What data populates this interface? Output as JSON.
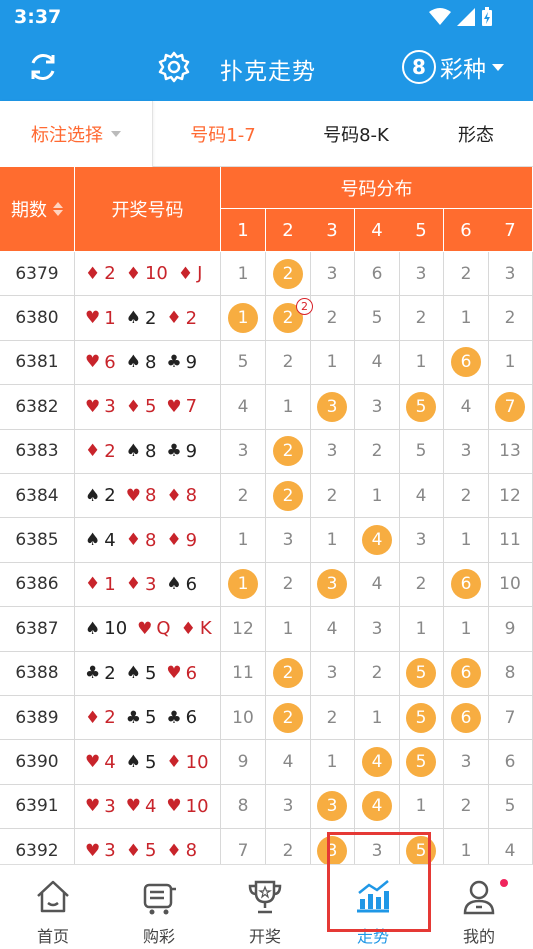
{
  "status_bar": {
    "time": "3:37"
  },
  "app_bar": {
    "title": "扑克走势",
    "variety_number": "8",
    "variety_label": "彩种"
  },
  "filter_tabs": {
    "mark_select": "标注选择",
    "tab1": "号码1-7",
    "tab2": "号码8-K",
    "tab3": "形态"
  },
  "table": {
    "headers": {
      "period": "期数",
      "draw": "开奖号码",
      "distribution": "号码分布"
    },
    "columns": [
      "1",
      "2",
      "3",
      "4",
      "5",
      "6",
      "7"
    ],
    "rows": [
      {
        "period": "6379",
        "cards": [
          [
            "♦",
            "2",
            "red"
          ],
          [
            "♦",
            "10",
            "red"
          ],
          [
            "♦",
            "J",
            "red"
          ]
        ],
        "cells": [
          [
            "1",
            false
          ],
          [
            "2",
            true
          ],
          [
            "3",
            false
          ],
          [
            "6",
            false
          ],
          [
            "3",
            false
          ],
          [
            "2",
            false
          ],
          [
            "3",
            false
          ]
        ]
      },
      {
        "period": "6380",
        "cards": [
          [
            "♥",
            "1",
            "red"
          ],
          [
            "♠",
            "2",
            "black"
          ],
          [
            "♦",
            "2",
            "red"
          ]
        ],
        "cells": [
          [
            "1",
            true
          ],
          [
            "2",
            true
          ],
          [
            "2",
            false
          ],
          [
            "5",
            false
          ],
          [
            "2",
            false
          ],
          [
            "1",
            false
          ],
          [
            "2",
            false
          ]
        ],
        "repeat_badge": "2"
      },
      {
        "period": "6381",
        "cards": [
          [
            "♥",
            "6",
            "red"
          ],
          [
            "♠",
            "8",
            "black"
          ],
          [
            "♣",
            "9",
            "black"
          ]
        ],
        "cells": [
          [
            "5",
            false
          ],
          [
            "2",
            false
          ],
          [
            "1",
            false
          ],
          [
            "4",
            false
          ],
          [
            "1",
            false
          ],
          [
            "6",
            true
          ],
          [
            "1",
            false
          ]
        ]
      },
      {
        "period": "6382",
        "cards": [
          [
            "♥",
            "3",
            "red"
          ],
          [
            "♦",
            "5",
            "red"
          ],
          [
            "♥",
            "7",
            "red"
          ]
        ],
        "cells": [
          [
            "4",
            false
          ],
          [
            "1",
            false
          ],
          [
            "3",
            true
          ],
          [
            "3",
            false
          ],
          [
            "5",
            true
          ],
          [
            "4",
            false
          ],
          [
            "7",
            true
          ]
        ]
      },
      {
        "period": "6383",
        "cards": [
          [
            "♦",
            "2",
            "red"
          ],
          [
            "♠",
            "8",
            "black"
          ],
          [
            "♣",
            "9",
            "black"
          ]
        ],
        "cells": [
          [
            "3",
            false
          ],
          [
            "2",
            true
          ],
          [
            "3",
            false
          ],
          [
            "2",
            false
          ],
          [
            "5",
            false
          ],
          [
            "3",
            false
          ],
          [
            "13",
            false
          ]
        ]
      },
      {
        "period": "6384",
        "cards": [
          [
            "♠",
            "2",
            "black"
          ],
          [
            "♥",
            "8",
            "red"
          ],
          [
            "♦",
            "8",
            "red"
          ]
        ],
        "cells": [
          [
            "2",
            false
          ],
          [
            "2",
            true
          ],
          [
            "2",
            false
          ],
          [
            "1",
            false
          ],
          [
            "4",
            false
          ],
          [
            "2",
            false
          ],
          [
            "12",
            false
          ]
        ]
      },
      {
        "period": "6385",
        "cards": [
          [
            "♠",
            "4",
            "black"
          ],
          [
            "♦",
            "8",
            "red"
          ],
          [
            "♦",
            "9",
            "red"
          ]
        ],
        "cells": [
          [
            "1",
            false
          ],
          [
            "3",
            false
          ],
          [
            "1",
            false
          ],
          [
            "4",
            true
          ],
          [
            "3",
            false
          ],
          [
            "1",
            false
          ],
          [
            "11",
            false
          ]
        ]
      },
      {
        "period": "6386",
        "cards": [
          [
            "♦",
            "1",
            "red"
          ],
          [
            "♦",
            "3",
            "red"
          ],
          [
            "♠",
            "6",
            "black"
          ]
        ],
        "cells": [
          [
            "1",
            true
          ],
          [
            "2",
            false
          ],
          [
            "3",
            true
          ],
          [
            "4",
            false
          ],
          [
            "2",
            false
          ],
          [
            "6",
            true
          ],
          [
            "10",
            false
          ]
        ]
      },
      {
        "period": "6387",
        "cards": [
          [
            "♠",
            "10",
            "black"
          ],
          [
            "♥",
            "Q",
            "red"
          ],
          [
            "♦",
            "K",
            "red"
          ]
        ],
        "cells": [
          [
            "12",
            false
          ],
          [
            "1",
            false
          ],
          [
            "4",
            false
          ],
          [
            "3",
            false
          ],
          [
            "1",
            false
          ],
          [
            "1",
            false
          ],
          [
            "9",
            false
          ]
        ]
      },
      {
        "period": "6388",
        "cards": [
          [
            "♣",
            "2",
            "black"
          ],
          [
            "♠",
            "5",
            "black"
          ],
          [
            "♥",
            "6",
            "red"
          ]
        ],
        "cells": [
          [
            "11",
            false
          ],
          [
            "2",
            true
          ],
          [
            "3",
            false
          ],
          [
            "2",
            false
          ],
          [
            "5",
            true
          ],
          [
            "6",
            true
          ],
          [
            "8",
            false
          ]
        ]
      },
      {
        "period": "6389",
        "cards": [
          [
            "♦",
            "2",
            "red"
          ],
          [
            "♣",
            "5",
            "black"
          ],
          [
            "♣",
            "6",
            "black"
          ]
        ],
        "cells": [
          [
            "10",
            false
          ],
          [
            "2",
            true
          ],
          [
            "2",
            false
          ],
          [
            "1",
            false
          ],
          [
            "5",
            true
          ],
          [
            "6",
            true
          ],
          [
            "7",
            false
          ]
        ]
      },
      {
        "period": "6390",
        "cards": [
          [
            "♥",
            "4",
            "red"
          ],
          [
            "♠",
            "5",
            "black"
          ],
          [
            "♦",
            "10",
            "red"
          ]
        ],
        "cells": [
          [
            "9",
            false
          ],
          [
            "4",
            false
          ],
          [
            "1",
            false
          ],
          [
            "4",
            true
          ],
          [
            "5",
            true
          ],
          [
            "3",
            false
          ],
          [
            "6",
            false
          ]
        ]
      },
      {
        "period": "6391",
        "cards": [
          [
            "♥",
            "3",
            "red"
          ],
          [
            "♥",
            "4",
            "red"
          ],
          [
            "♥",
            "10",
            "red"
          ]
        ],
        "cells": [
          [
            "8",
            false
          ],
          [
            "3",
            false
          ],
          [
            "3",
            true
          ],
          [
            "4",
            true
          ],
          [
            "1",
            false
          ],
          [
            "2",
            false
          ],
          [
            "5",
            false
          ]
        ]
      },
      {
        "period": "6392",
        "cards": [
          [
            "♥",
            "3",
            "red"
          ],
          [
            "♦",
            "5",
            "red"
          ],
          [
            "♦",
            "8",
            "red"
          ]
        ],
        "cells": [
          [
            "7",
            false
          ],
          [
            "2",
            false
          ],
          [
            "3",
            true
          ],
          [
            "3",
            false
          ],
          [
            "5",
            true
          ],
          [
            "1",
            false
          ],
          [
            "4",
            false
          ]
        ]
      }
    ]
  },
  "bottom_nav": [
    {
      "label": "首页",
      "icon": "home-icon"
    },
    {
      "label": "购彩",
      "icon": "cart-icon"
    },
    {
      "label": "开奖",
      "icon": "trophy-icon"
    },
    {
      "label": "走势",
      "icon": "trend-chart-icon",
      "active": true
    },
    {
      "label": "我的",
      "icon": "user-icon"
    }
  ],
  "colors": {
    "primary": "#1f97e6",
    "header_orange": "#ff6c2f",
    "ball": "#f7ad41",
    "red_suit": "#c8242b"
  }
}
